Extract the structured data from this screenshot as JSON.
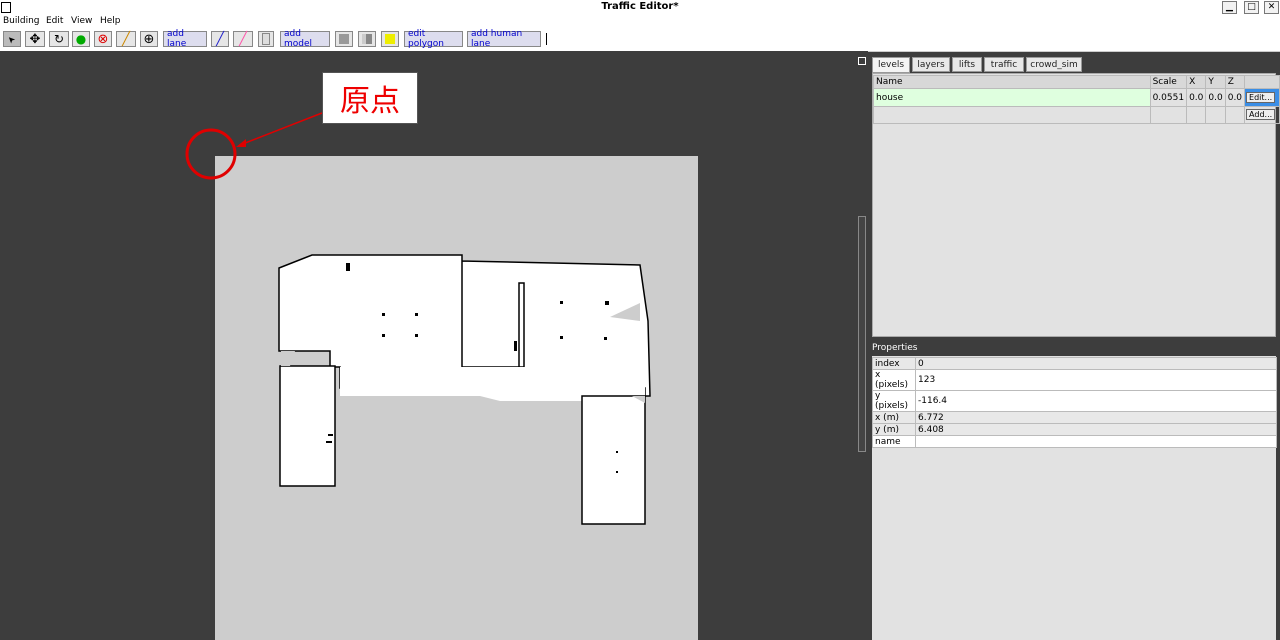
{
  "window": {
    "title": "Traffic Editor*"
  },
  "menu": [
    "Building",
    "Edit",
    "View",
    "Help"
  ],
  "toolbar": {
    "tools": [
      {
        "icon": "select-arrow-icon",
        "glyph": "➤"
      },
      {
        "icon": "move-icon",
        "glyph": "✥"
      },
      {
        "icon": "rotate-icon",
        "glyph": "↻"
      },
      {
        "icon": "add-vertex-icon",
        "glyph": "●"
      },
      {
        "icon": "delete-icon",
        "glyph": "⊗"
      },
      {
        "icon": "add-wall-icon",
        "glyph": "╱"
      },
      {
        "icon": "add-measurement-icon",
        "glyph": "⊕"
      }
    ],
    "add_lane": "add lane",
    "add_model": "add model",
    "edit_polygon": "edit polygon",
    "add_human_lane": "add human lane"
  },
  "annotation": {
    "label": "原点"
  },
  "tabs": [
    "levels",
    "layers",
    "lifts",
    "traffic",
    "crowd_sim"
  ],
  "levels": {
    "headers": [
      "Name",
      "Scale",
      "X",
      "Y",
      "Z"
    ],
    "rows": [
      {
        "name": "house",
        "scale": "0.0551",
        "x": "0.0",
        "y": "0.0",
        "z": "0.0",
        "button": "Edit..."
      }
    ],
    "add_button": "Add..."
  },
  "properties": {
    "title": "Properties",
    "rows": [
      {
        "key": "index",
        "value": "0"
      },
      {
        "key": "x (pixels)",
        "value": "123"
      },
      {
        "key": "y (pixels)",
        "value": "-116.4"
      },
      {
        "key": "x (m)",
        "value": "6.772"
      },
      {
        "key": "y (m)",
        "value": "6.408"
      },
      {
        "key": "name",
        "value": ""
      }
    ]
  },
  "colors": {
    "annotation": "#e00000",
    "selected_row": "#dfffdf",
    "canvas": "#3d3d3d",
    "map_unknown": "#cdcdcd"
  }
}
